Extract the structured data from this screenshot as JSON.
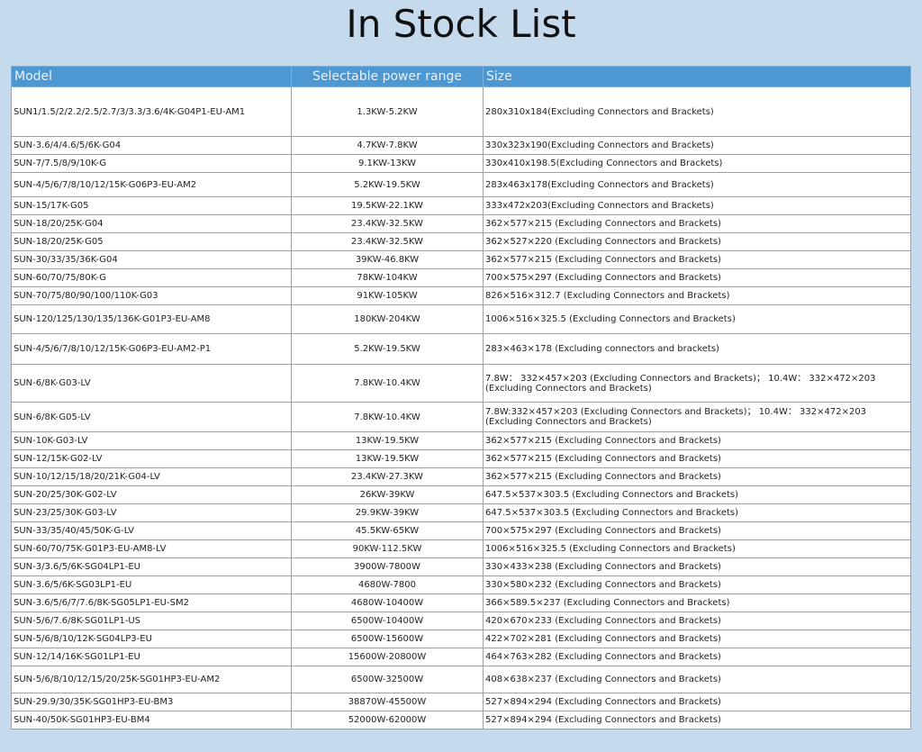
{
  "title": "In Stock List",
  "columns": [
    "Model",
    "Selectable power range",
    "Size"
  ],
  "rows": [
    {
      "model": "SUN1/1.5/2/2.2/2.5/2.7/3/3.3/3.6/4K-G04P1-EU-AM1",
      "range": "1.3KW-5.2KW",
      "size": "280x310x184(Excluding Connectors and Brackets)"
    },
    {
      "model": "SUN-3.6/4/4.6/5/6K-G04",
      "range": "4.7KW-7.8KW",
      "size": "330x323x190(Excluding Connectors and Brackets)"
    },
    {
      "model": "SUN-7/7.5/8/9/10K-G",
      "range": "9.1KW-13KW",
      "size": "330x410x198.5(Excluding Connectors and Brackets)"
    },
    {
      "model": "SUN-4/5/6/7/8/10/12/15K-G06P3-EU-AM2",
      "range": "5.2KW-19.5KW",
      "size": "283x463x178(Excluding Connectors and Brackets)"
    },
    {
      "model": "SUN-15/17K-G05",
      "range": "19.5KW-22.1KW",
      "size": "333x472x203(Excluding Connectors and Brackets)"
    },
    {
      "model": "SUN-18/20/25K-G04",
      "range": "23.4KW-32.5KW",
      "size": "362×577×215 (Excluding Connectors and Brackets)"
    },
    {
      "model": "SUN-18/20/25K-G05",
      "range": "23.4KW-32.5KW",
      "size": "362×527×220 (Excluding Connectors and Brackets)"
    },
    {
      "model": "SUN-30/33/35/36K-G04",
      "range": "39KW-46.8KW",
      "size": "362×577×215 (Excluding Connectors and Brackets)"
    },
    {
      "model": "SUN-60/70/75/80K-G",
      "range": "78KW-104KW",
      "size": "700×575×297 (Excluding Connectors and Brackets)"
    },
    {
      "model": "SUN-70/75/80/90/100/110K-G03",
      "range": "91KW-105KW",
      "size": "826×516×312.7 (Excluding Connectors and Brackets)"
    },
    {
      "model": "SUN-120/125/130/135/136K-G01P3-EU-AM8",
      "range": "180KW-204KW",
      "size": "1006×516×325.5 (Excluding Connectors and Brackets)"
    },
    {
      "model": "SUN-4/5/6/7/8/10/12/15K-G06P3-EU-AM2-P1",
      "range": "5.2KW-19.5KW",
      "size": "283×463×178 (Excluding connectors and brackets)"
    },
    {
      "model": "SUN-6/8K-G03-LV",
      "range": "7.8KW-10.4KW",
      "size": "7.8W： 332×457×203 (Excluding Connectors and Brackets)； 10.4W： 332×472×203 (Excluding Connectors and Brackets)"
    },
    {
      "model": "SUN-6/8K-G05-LV",
      "range": "7.8KW-10.4KW",
      "size": "7.8W:332×457×203 (Excluding Connectors and Brackets)； 10.4W： 332×472×203 (Excluding Connectors and Brackets)"
    },
    {
      "model": "SUN-10K-G03-LV",
      "range": "13KW-19.5KW",
      "size": "362×577×215 (Excluding Connectors and Brackets)"
    },
    {
      "model": "SUN-12/15K-G02-LV",
      "range": "13KW-19.5KW",
      "size": "362×577×215 (Excluding Connectors and Brackets)"
    },
    {
      "model": "SUN-10/12/15/18/20/21K-G04-LV",
      "range": "23.4KW-27.3KW",
      "size": "362×577×215 (Excluding Connectors and Brackets)"
    },
    {
      "model": "SUN-20/25/30K-G02-LV",
      "range": "26KW-39KW",
      "size": "647.5×537×303.5 (Excluding Connectors and Brackets)"
    },
    {
      "model": "SUN-23/25/30K-G03-LV",
      "range": "29.9KW-39KW",
      "size": "647.5×537×303.5 (Excluding Connectors and Brackets)"
    },
    {
      "model": "SUN-33/35/40/45/50K-G-LV",
      "range": "45.5KW-65KW",
      "size": "700×575×297 (Excluding Connectors and Brackets)"
    },
    {
      "model": "SUN-60/70/75K-G01P3-EU-AM8-LV",
      "range": "90KW-112.5KW",
      "size": "1006×516×325.5 (Excluding Connectors and Brackets)"
    },
    {
      "model": "SUN-3/3.6/5/6K-SG04LP1-EU",
      "range": "3900W-7800W",
      "size": "330×433×238 (Excluding Connectors and Brackets)"
    },
    {
      "model": "SUN-3.6/5/6K-SG03LP1-EU",
      "range": "4680W-7800",
      "size": "330×580×232 (Excluding Connectors and Brackets)"
    },
    {
      "model": "SUN-3.6/5/6/7/7.6/8K-SG05LP1-EU-SM2",
      "range": "4680W-10400W",
      "size": "366×589.5×237 (Excluding Connectors and Brackets)"
    },
    {
      "model": "SUN-5/6/7.6/8K-SG01LP1-US",
      "range": "6500W-10400W",
      "size": "420×670×233 (Excluding Connectors and Brackets)"
    },
    {
      "model": "SUN-5/6/8/10/12K-SG04LP3-EU",
      "range": "6500W-15600W",
      "size": "422×702×281 (Excluding Connectors and Brackets)"
    },
    {
      "model": "SUN-12/14/16K-SG01LP1-EU",
      "range": "15600W-20800W",
      "size": "464×763×282 (Excluding Connectors and Brackets)"
    },
    {
      "model": "SUN-5/6/8/10/12/15/20/25K-SG01HP3-EU-AM2",
      "range": "6500W-32500W",
      "size": "408×638×237 (Excluding Connectors and Brackets)"
    },
    {
      "model": "SUN-29.9/30/35K-SG01HP3-EU-BM3",
      "range": "38870W-45500W",
      "size": "527×894×294 (Excluding Connectors and Brackets)"
    },
    {
      "model": "SUN-40/50K-SG01HP3-EU-BM4",
      "range": "52000W-62000W",
      "size": "527×894×294 (Excluding Connectors and Brackets)"
    }
  ]
}
